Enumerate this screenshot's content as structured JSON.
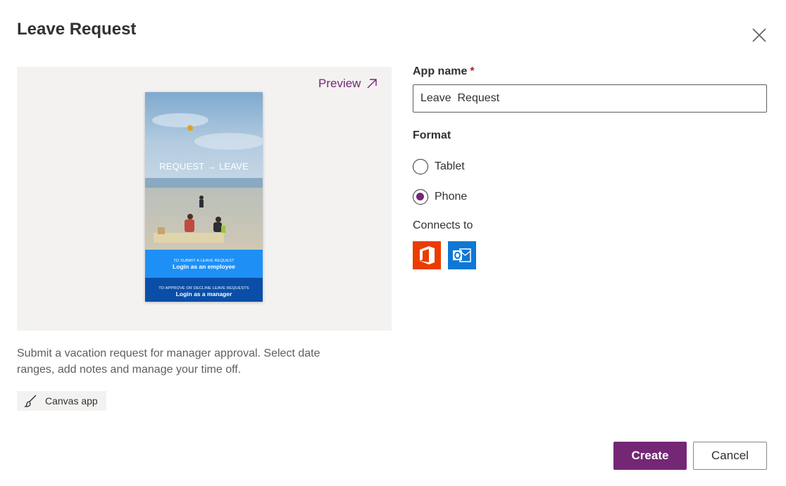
{
  "dialog": {
    "title": "Leave Request"
  },
  "preview": {
    "link_label": "Preview",
    "phone": {
      "headline": "REQUEST → LEAVE",
      "employee_caption": "TO SUBMIT A LEAVE REQUEST",
      "employee_action": "Login as an employee",
      "manager_caption": "TO APPROVE OR DECLINE LEAVE REQUESTS",
      "manager_action": "Login as a manager"
    }
  },
  "description": "Submit a vacation request for manager approval. Select date ranges, add notes and manage your time off.",
  "tag": {
    "label": "Canvas app",
    "icon": "brush-icon"
  },
  "form": {
    "app_name_label": "App name",
    "required_marker": "*",
    "app_name_value": "Leave  Request",
    "format_label": "Format",
    "format_options": [
      {
        "label": "Tablet",
        "selected": false
      },
      {
        "label": "Phone",
        "selected": true
      }
    ],
    "connects_label": "Connects to",
    "connectors": [
      {
        "icon": "office365-icon",
        "color": "#eb3c00"
      },
      {
        "icon": "outlook-icon",
        "color": "#0f78d4"
      }
    ]
  },
  "buttons": {
    "create": "Create",
    "cancel": "Cancel"
  },
  "colors": {
    "accent": "#742774",
    "required": "#a4262c"
  }
}
